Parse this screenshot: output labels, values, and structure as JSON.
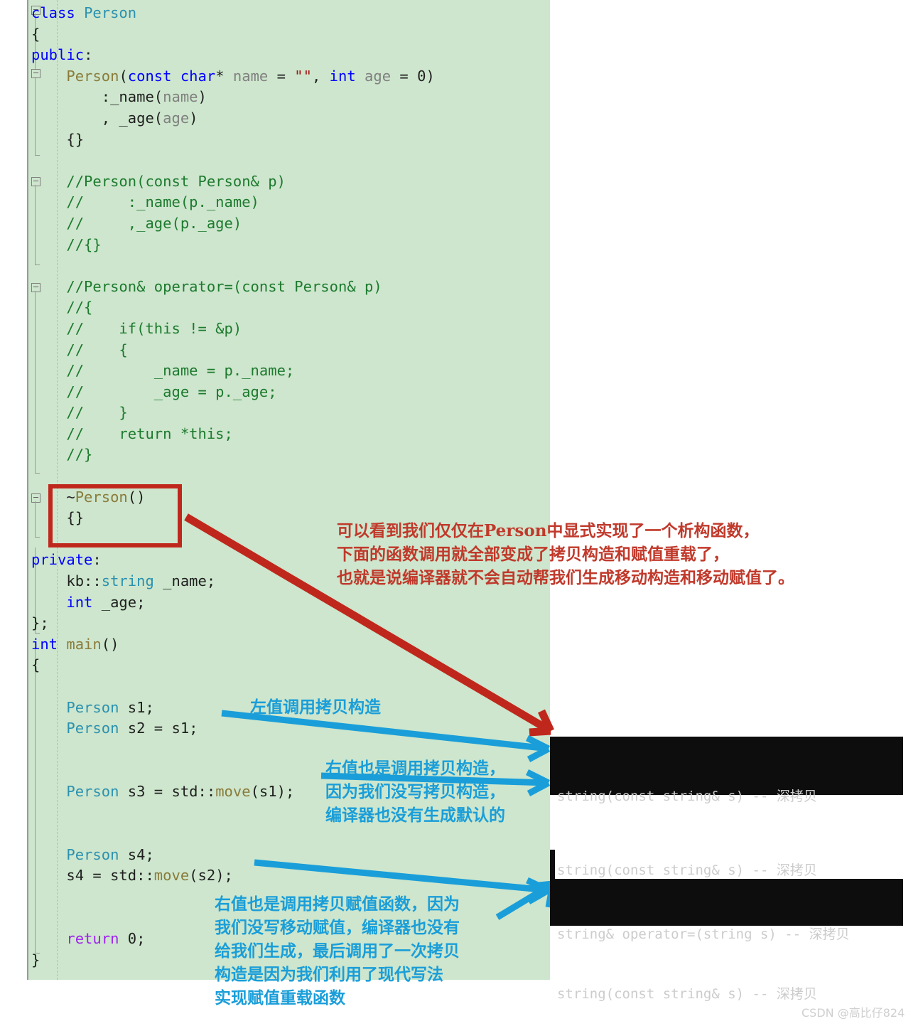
{
  "editor": {
    "background_color": "#cde6cd",
    "code_lines": [
      [
        {
          "t": "class ",
          "c": "kw"
        },
        {
          "t": "Person",
          "c": "ty"
        }
      ],
      [
        {
          "t": "{",
          "c": "pl"
        }
      ],
      [
        {
          "t": "public",
          "c": "kw"
        },
        {
          "t": ":",
          "c": "pl"
        }
      ],
      [
        {
          "t": "    ",
          "c": "pl"
        },
        {
          "t": "Person",
          "c": "fn"
        },
        {
          "t": "(",
          "c": "pl"
        },
        {
          "t": "const char",
          "c": "kw"
        },
        {
          "t": "* ",
          "c": "pl"
        },
        {
          "t": "name",
          "c": "gy"
        },
        {
          "t": " = ",
          "c": "pl"
        },
        {
          "t": "\"\"",
          "c": "st"
        },
        {
          "t": ", ",
          "c": "pl"
        },
        {
          "t": "int",
          "c": "kw"
        },
        {
          "t": " ",
          "c": "pl"
        },
        {
          "t": "age",
          "c": "gy"
        },
        {
          "t": " = 0)",
          "c": "pl"
        }
      ],
      [
        {
          "t": "        :_name(",
          "c": "pl"
        },
        {
          "t": "name",
          "c": "gy"
        },
        {
          "t": ")",
          "c": "pl"
        }
      ],
      [
        {
          "t": "        , _age(",
          "c": "pl"
        },
        {
          "t": "age",
          "c": "gy"
        },
        {
          "t": ")",
          "c": "pl"
        }
      ],
      [
        {
          "t": "    {}",
          "c": "pl"
        }
      ],
      [
        {
          "t": "",
          "c": "pl"
        }
      ],
      [
        {
          "t": "    //Person(const Person& p)",
          "c": "cm"
        }
      ],
      [
        {
          "t": "    //     :_name(p._name)",
          "c": "cm"
        }
      ],
      [
        {
          "t": "    //     ,_age(p._age)",
          "c": "cm"
        }
      ],
      [
        {
          "t": "    //{}",
          "c": "cm"
        }
      ],
      [
        {
          "t": "",
          "c": "pl"
        }
      ],
      [
        {
          "t": "    //Person& operator=(const Person& p)",
          "c": "cm"
        }
      ],
      [
        {
          "t": "    //{",
          "c": "cm"
        }
      ],
      [
        {
          "t": "    //    if(this != &p)",
          "c": "cm"
        }
      ],
      [
        {
          "t": "    //    {",
          "c": "cm"
        }
      ],
      [
        {
          "t": "    //        _name = p._name;",
          "c": "cm"
        }
      ],
      [
        {
          "t": "    //        _age = p._age;",
          "c": "cm"
        }
      ],
      [
        {
          "t": "    //    }",
          "c": "cm"
        }
      ],
      [
        {
          "t": "    //    return *this;",
          "c": "cm"
        }
      ],
      [
        {
          "t": "    //}",
          "c": "cm"
        }
      ],
      [
        {
          "t": "",
          "c": "pl"
        }
      ],
      [
        {
          "t": "    ~",
          "c": "pl"
        },
        {
          "t": "Person",
          "c": "fn"
        },
        {
          "t": "()",
          "c": "pl"
        }
      ],
      [
        {
          "t": "    {}",
          "c": "pl"
        }
      ],
      [
        {
          "t": "",
          "c": "pl"
        }
      ],
      [
        {
          "t": "private",
          "c": "kw"
        },
        {
          "t": ":",
          "c": "pl"
        }
      ],
      [
        {
          "t": "    kb::",
          "c": "pl"
        },
        {
          "t": "string",
          "c": "ty"
        },
        {
          "t": " _name;",
          "c": "pl"
        }
      ],
      [
        {
          "t": "    ",
          "c": "pl"
        },
        {
          "t": "int",
          "c": "kw"
        },
        {
          "t": " _age;",
          "c": "pl"
        }
      ],
      [
        {
          "t": "};",
          "c": "pl"
        }
      ],
      [
        {
          "t": "int",
          "c": "kw"
        },
        {
          "t": " ",
          "c": "pl"
        },
        {
          "t": "main",
          "c": "fn"
        },
        {
          "t": "()",
          "c": "pl"
        }
      ],
      [
        {
          "t": "{",
          "c": "pl"
        }
      ],
      [
        {
          "t": "",
          "c": "pl"
        }
      ],
      [
        {
          "t": "    ",
          "c": "pl"
        },
        {
          "t": "Person",
          "c": "ty"
        },
        {
          "t": " s1;",
          "c": "pl"
        }
      ],
      [
        {
          "t": "    ",
          "c": "pl"
        },
        {
          "t": "Person",
          "c": "ty"
        },
        {
          "t": " s2 = s1;",
          "c": "pl"
        }
      ],
      [
        {
          "t": "",
          "c": "pl"
        }
      ],
      [
        {
          "t": "",
          "c": "pl"
        }
      ],
      [
        {
          "t": "    ",
          "c": "pl"
        },
        {
          "t": "Person",
          "c": "ty"
        },
        {
          "t": " s3 = std::",
          "c": "pl"
        },
        {
          "t": "move",
          "c": "fn"
        },
        {
          "t": "(s1);",
          "c": "pl"
        }
      ],
      [
        {
          "t": "",
          "c": "pl"
        }
      ],
      [
        {
          "t": "",
          "c": "pl"
        }
      ],
      [
        {
          "t": "    ",
          "c": "pl"
        },
        {
          "t": "Person",
          "c": "ty"
        },
        {
          "t": " s4;",
          "c": "pl"
        }
      ],
      [
        {
          "t": "    s4 = std::",
          "c": "pl"
        },
        {
          "t": "move",
          "c": "fn"
        },
        {
          "t": "(s2);",
          "c": "pl"
        }
      ],
      [
        {
          "t": "",
          "c": "pl"
        }
      ],
      [
        {
          "t": "",
          "c": "pl"
        }
      ],
      [
        {
          "t": "    ",
          "c": "pl"
        },
        {
          "t": "return",
          "c": "pp"
        },
        {
          "t": " 0;",
          "c": "pl"
        }
      ],
      [
        {
          "t": "}",
          "c": "pl"
        }
      ]
    ]
  },
  "highlight_box": {
    "color": "#c0271c",
    "target_lines": "~Person()  {}"
  },
  "annotations": {
    "red_note": "可以看到我们仅仅在Person中显式实现了一个析构函数，\n下面的函数调用就全部变成了拷贝构造和赋值重载了，\n也就是说编译器就不会自动帮我们生成移动构造和移动赋值了。",
    "red_note_color": "#c0392b",
    "blue_note_1": "左值调用拷贝构造",
    "blue_note_2": "右值也是调用拷贝构造，\n因为我们没写拷贝构造，\n编译器也没有生成默认的",
    "blue_note_3": "右值也是调用拷贝赋值函数，因为\n我们没写移动赋值，编译器也没有\n给我们生成，最后调用了一次拷贝\n构造是因为我们利用了现代写法\n实现赋值重载函数",
    "blue_note_color": "#1a9ed9"
  },
  "console_1": {
    "lines": [
      "string(const string& s) -- 深拷贝",
      "string(const string& s) -- 深拷贝"
    ]
  },
  "console_2": {
    "lines": [
      "string& operator=(string s) -- 深拷贝",
      "string(const string& s) -- 深拷贝"
    ]
  },
  "watermark": {
    "text": "CSDN @高比仔824"
  }
}
